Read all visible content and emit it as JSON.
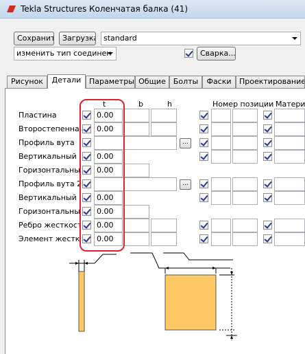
{
  "window": {
    "title": "Tekla Structures  Коленчатая балка (41)"
  },
  "toolbar": {
    "save_label": "Сохранить",
    "load_label": "Загрузка",
    "preset_value": "standard",
    "modify_value": "изменить тип соединен",
    "weld_label": "Сварка..."
  },
  "tabs": [
    {
      "label": "Рисунок"
    },
    {
      "label": "Детали"
    },
    {
      "label": "Параметры"
    },
    {
      "label": "Общие"
    },
    {
      "label": "Болты"
    },
    {
      "label": "Фаски"
    },
    {
      "label": "Проектирование"
    }
  ],
  "columns": {
    "t": "t",
    "b": "b",
    "h": "h",
    "position": "Номер позиции",
    "material": "Материал"
  },
  "rows": [
    {
      "label": "Пластина",
      "t": "0.00"
    },
    {
      "label": "Второстепенная",
      "t": "0.00"
    },
    {
      "label": "Профиль вута",
      "t": ""
    },
    {
      "label": "Вертикальный вут",
      "t": "0.00"
    },
    {
      "label": "Горизонтальный",
      "t": "0.00"
    },
    {
      "label": "Профиль вута 2",
      "t": ""
    },
    {
      "label": "Вертикальный вут",
      "t": "0.00"
    },
    {
      "label": "Горизонтальный",
      "t": "0.00"
    },
    {
      "label": "Ребро жесткости",
      "t": "0.00"
    },
    {
      "label": "Элемент жесткости",
      "t": "0.00"
    }
  ],
  "browse_label": "...",
  "colors": {
    "highlight": "#e0202a",
    "part_fill": "#ffc966",
    "title_bar": "#c5d7ec"
  }
}
